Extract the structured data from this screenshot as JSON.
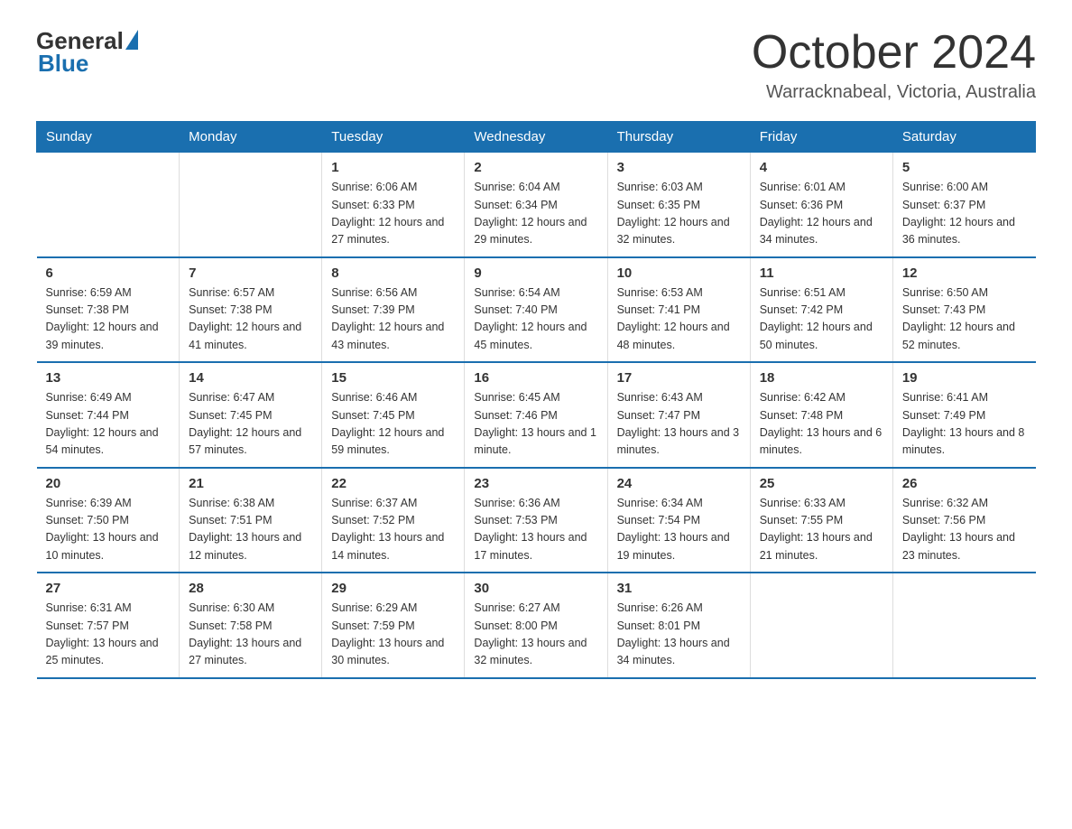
{
  "header": {
    "logo_general": "General",
    "logo_blue": "Blue",
    "title": "October 2024",
    "location": "Warracknabeal, Victoria, Australia"
  },
  "days_of_week": [
    "Sunday",
    "Monday",
    "Tuesday",
    "Wednesday",
    "Thursday",
    "Friday",
    "Saturday"
  ],
  "weeks": [
    [
      {
        "day": "",
        "info": ""
      },
      {
        "day": "",
        "info": ""
      },
      {
        "day": "1",
        "info": "Sunrise: 6:06 AM\nSunset: 6:33 PM\nDaylight: 12 hours\nand 27 minutes."
      },
      {
        "day": "2",
        "info": "Sunrise: 6:04 AM\nSunset: 6:34 PM\nDaylight: 12 hours\nand 29 minutes."
      },
      {
        "day": "3",
        "info": "Sunrise: 6:03 AM\nSunset: 6:35 PM\nDaylight: 12 hours\nand 32 minutes."
      },
      {
        "day": "4",
        "info": "Sunrise: 6:01 AM\nSunset: 6:36 PM\nDaylight: 12 hours\nand 34 minutes."
      },
      {
        "day": "5",
        "info": "Sunrise: 6:00 AM\nSunset: 6:37 PM\nDaylight: 12 hours\nand 36 minutes."
      }
    ],
    [
      {
        "day": "6",
        "info": "Sunrise: 6:59 AM\nSunset: 7:38 PM\nDaylight: 12 hours\nand 39 minutes."
      },
      {
        "day": "7",
        "info": "Sunrise: 6:57 AM\nSunset: 7:38 PM\nDaylight: 12 hours\nand 41 minutes."
      },
      {
        "day": "8",
        "info": "Sunrise: 6:56 AM\nSunset: 7:39 PM\nDaylight: 12 hours\nand 43 minutes."
      },
      {
        "day": "9",
        "info": "Sunrise: 6:54 AM\nSunset: 7:40 PM\nDaylight: 12 hours\nand 45 minutes."
      },
      {
        "day": "10",
        "info": "Sunrise: 6:53 AM\nSunset: 7:41 PM\nDaylight: 12 hours\nand 48 minutes."
      },
      {
        "day": "11",
        "info": "Sunrise: 6:51 AM\nSunset: 7:42 PM\nDaylight: 12 hours\nand 50 minutes."
      },
      {
        "day": "12",
        "info": "Sunrise: 6:50 AM\nSunset: 7:43 PM\nDaylight: 12 hours\nand 52 minutes."
      }
    ],
    [
      {
        "day": "13",
        "info": "Sunrise: 6:49 AM\nSunset: 7:44 PM\nDaylight: 12 hours\nand 54 minutes."
      },
      {
        "day": "14",
        "info": "Sunrise: 6:47 AM\nSunset: 7:45 PM\nDaylight: 12 hours\nand 57 minutes."
      },
      {
        "day": "15",
        "info": "Sunrise: 6:46 AM\nSunset: 7:45 PM\nDaylight: 12 hours\nand 59 minutes."
      },
      {
        "day": "16",
        "info": "Sunrise: 6:45 AM\nSunset: 7:46 PM\nDaylight: 13 hours\nand 1 minute."
      },
      {
        "day": "17",
        "info": "Sunrise: 6:43 AM\nSunset: 7:47 PM\nDaylight: 13 hours\nand 3 minutes."
      },
      {
        "day": "18",
        "info": "Sunrise: 6:42 AM\nSunset: 7:48 PM\nDaylight: 13 hours\nand 6 minutes."
      },
      {
        "day": "19",
        "info": "Sunrise: 6:41 AM\nSunset: 7:49 PM\nDaylight: 13 hours\nand 8 minutes."
      }
    ],
    [
      {
        "day": "20",
        "info": "Sunrise: 6:39 AM\nSunset: 7:50 PM\nDaylight: 13 hours\nand 10 minutes."
      },
      {
        "day": "21",
        "info": "Sunrise: 6:38 AM\nSunset: 7:51 PM\nDaylight: 13 hours\nand 12 minutes."
      },
      {
        "day": "22",
        "info": "Sunrise: 6:37 AM\nSunset: 7:52 PM\nDaylight: 13 hours\nand 14 minutes."
      },
      {
        "day": "23",
        "info": "Sunrise: 6:36 AM\nSunset: 7:53 PM\nDaylight: 13 hours\nand 17 minutes."
      },
      {
        "day": "24",
        "info": "Sunrise: 6:34 AM\nSunset: 7:54 PM\nDaylight: 13 hours\nand 19 minutes."
      },
      {
        "day": "25",
        "info": "Sunrise: 6:33 AM\nSunset: 7:55 PM\nDaylight: 13 hours\nand 21 minutes."
      },
      {
        "day": "26",
        "info": "Sunrise: 6:32 AM\nSunset: 7:56 PM\nDaylight: 13 hours\nand 23 minutes."
      }
    ],
    [
      {
        "day": "27",
        "info": "Sunrise: 6:31 AM\nSunset: 7:57 PM\nDaylight: 13 hours\nand 25 minutes."
      },
      {
        "day": "28",
        "info": "Sunrise: 6:30 AM\nSunset: 7:58 PM\nDaylight: 13 hours\nand 27 minutes."
      },
      {
        "day": "29",
        "info": "Sunrise: 6:29 AM\nSunset: 7:59 PM\nDaylight: 13 hours\nand 30 minutes."
      },
      {
        "day": "30",
        "info": "Sunrise: 6:27 AM\nSunset: 8:00 PM\nDaylight: 13 hours\nand 32 minutes."
      },
      {
        "day": "31",
        "info": "Sunrise: 6:26 AM\nSunset: 8:01 PM\nDaylight: 13 hours\nand 34 minutes."
      },
      {
        "day": "",
        "info": ""
      },
      {
        "day": "",
        "info": ""
      }
    ]
  ]
}
